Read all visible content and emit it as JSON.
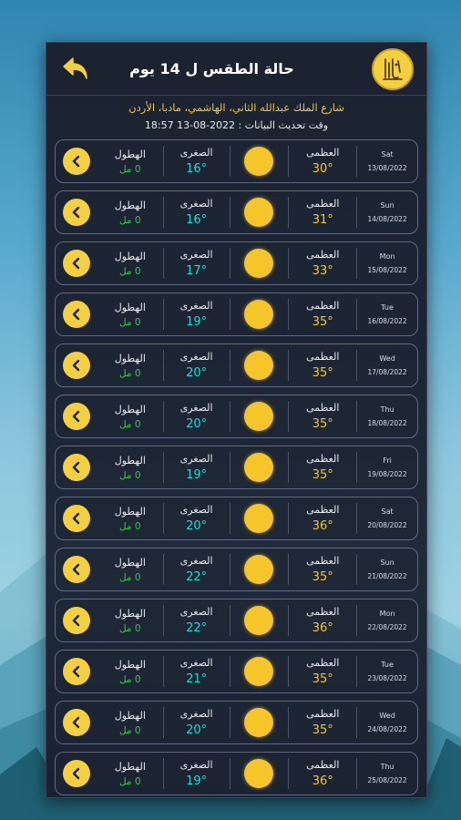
{
  "header": {
    "title": "حالة الطقس ل 14 يوم",
    "address": "شارع الملك عبدالله الثاني، الهاشمي، مادبا، الأردن",
    "updated": "وقت تحديث البيانات : 2022-08-13 18:57"
  },
  "labels": {
    "rain": "الهطول",
    "min": "الصغرى",
    "max": "العظمى"
  },
  "colors": {
    "accent": "#f4cf3e",
    "min_temp": "#2ad7d0",
    "rain": "#38c94a",
    "max_temp": "#f2c631"
  },
  "icons": {
    "back": "back-arrow-icon",
    "row_action": "chevron-left-icon",
    "weather": "sun-icon",
    "logo": "calligraphy-logo-icon"
  },
  "days": [
    {
      "day": "Sat",
      "date": "13/08/2022",
      "max": "30°",
      "min": "16°",
      "rain": "0 مل"
    },
    {
      "day": "Sun",
      "date": "14/08/2022",
      "max": "31°",
      "min": "16°",
      "rain": "0 مل"
    },
    {
      "day": "Mon",
      "date": "15/08/2022",
      "max": "33°",
      "min": "17°",
      "rain": "0 مل"
    },
    {
      "day": "Tue",
      "date": "16/08/2022",
      "max": "35°",
      "min": "19°",
      "rain": "0 مل"
    },
    {
      "day": "Wed",
      "date": "17/08/2022",
      "max": "35°",
      "min": "20°",
      "rain": "0 مل"
    },
    {
      "day": "Thu",
      "date": "18/08/2022",
      "max": "35°",
      "min": "20°",
      "rain": "0 مل"
    },
    {
      "day": "Fri",
      "date": "19/08/2022",
      "max": "35°",
      "min": "19°",
      "rain": "0 مل"
    },
    {
      "day": "Sat",
      "date": "20/08/2022",
      "max": "36°",
      "min": "20°",
      "rain": "0 مل"
    },
    {
      "day": "Sun",
      "date": "21/08/2022",
      "max": "35°",
      "min": "22°",
      "rain": "0 مل"
    },
    {
      "day": "Mon",
      "date": "22/08/2022",
      "max": "36°",
      "min": "22°",
      "rain": "0 مل"
    },
    {
      "day": "Tue",
      "date": "23/08/2022",
      "max": "35°",
      "min": "21°",
      "rain": "0 مل"
    },
    {
      "day": "Wed",
      "date": "24/08/2022",
      "max": "35°",
      "min": "20°",
      "rain": "0 مل"
    },
    {
      "day": "Thu",
      "date": "25/08/2022",
      "max": "36°",
      "min": "19°",
      "rain": "0 مل"
    }
  ]
}
